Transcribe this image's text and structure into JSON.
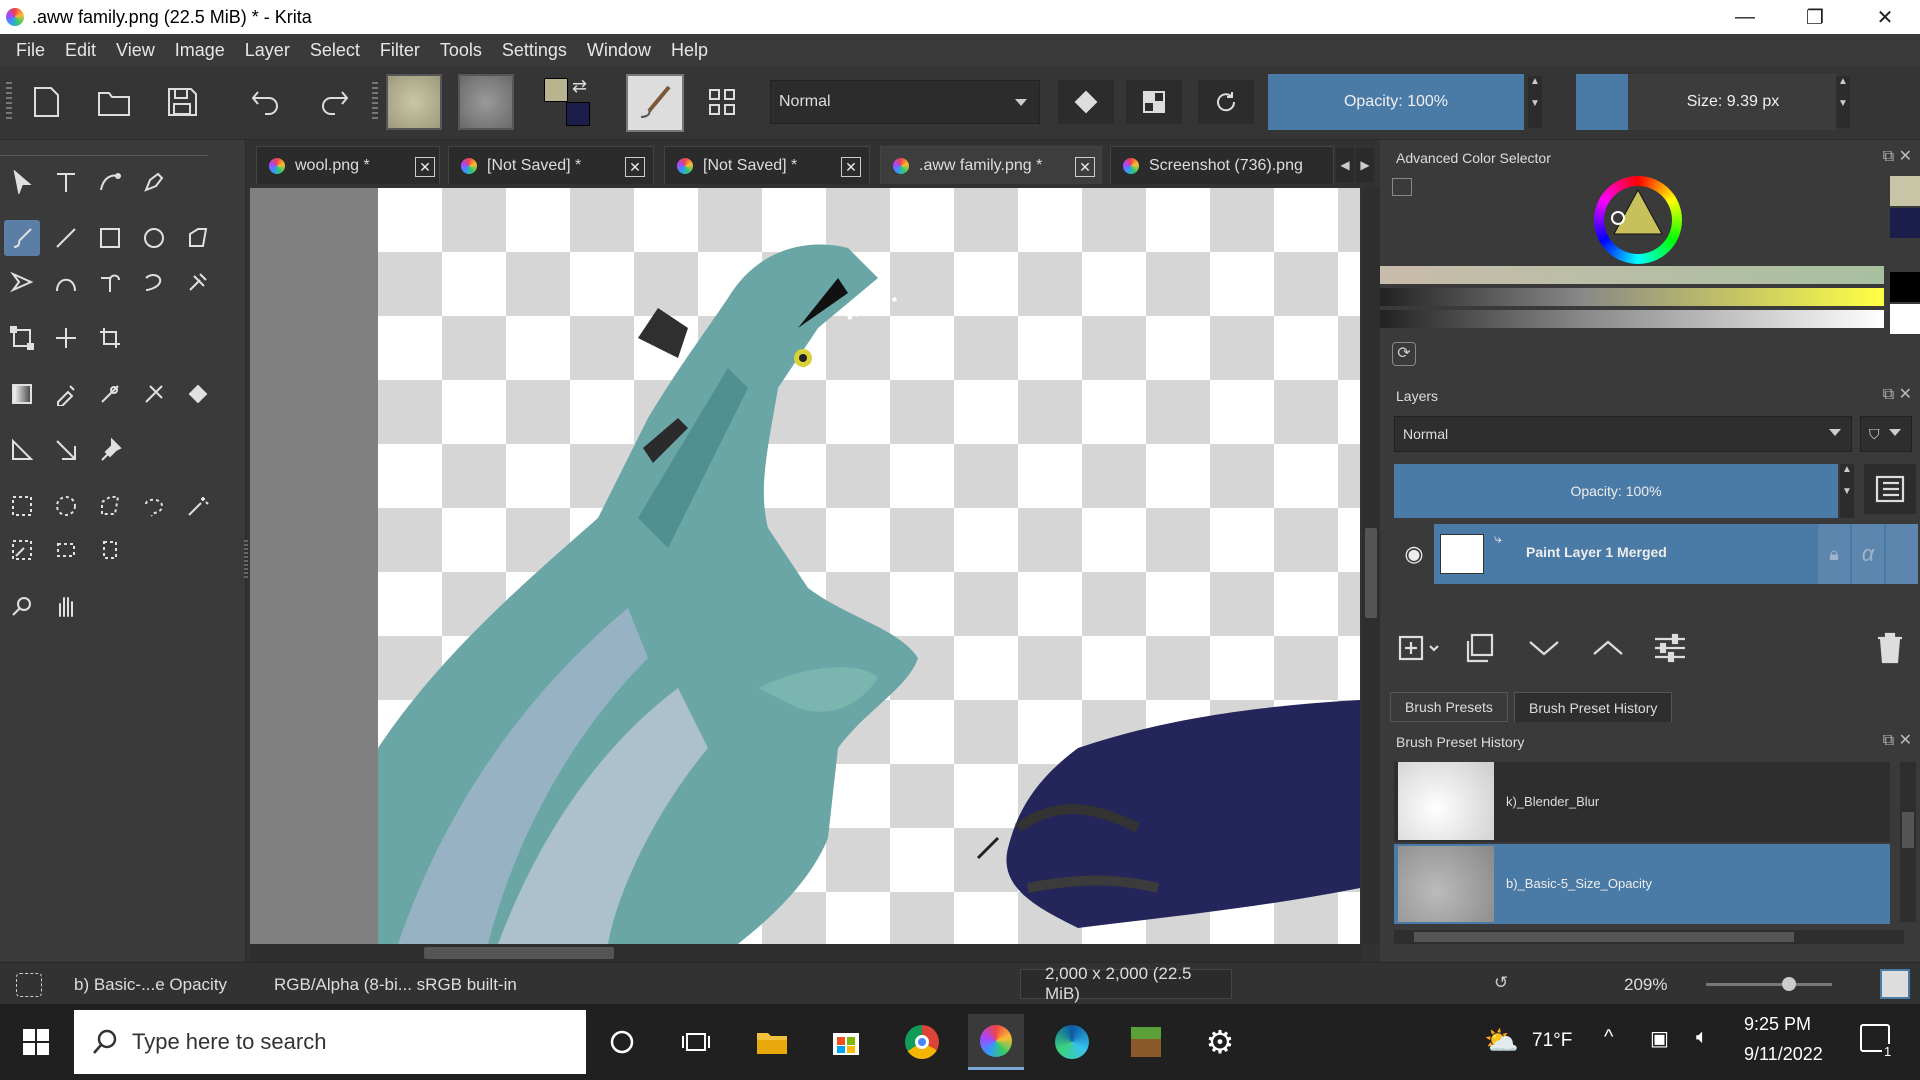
{
  "window": {
    "title": ".aww family.png (22.5 MiB)  * - Krita",
    "controls": [
      "—",
      "❐",
      "✕"
    ]
  },
  "menu": [
    "File",
    "Edit",
    "View",
    "Image",
    "Layer",
    "Select",
    "Filter",
    "Tools",
    "Settings",
    "Window",
    "Help"
  ],
  "toolbar": {
    "blend_mode": "Normal",
    "opacity_label": "Opacity: 100%",
    "size_label": "Size: 9.39 px",
    "fg_color": "#b9b48f",
    "bg_color": "#1b1d4a"
  },
  "tabs": [
    {
      "label": "wool.png *",
      "close": "✕"
    },
    {
      "label": "[Not Saved]  *",
      "close": "✕"
    },
    {
      "label": "[Not Saved]  *",
      "close": "✕"
    },
    {
      "label": ".aww family.png *",
      "close": "✕"
    },
    {
      "label": "Screenshot (736).png",
      "close": ""
    }
  ],
  "color_selector": {
    "title": "Advanced Color Selector",
    "swatches": [
      "#c7c5a6",
      "#1b1d4a",
      "#3a3a3a",
      "#000000",
      "#ffffff",
      "#303030"
    ]
  },
  "layers": {
    "title": "Layers",
    "blend_mode": "Normal",
    "opacity_label": "Opacity:  100%",
    "items": [
      {
        "name": "Paint Layer 1 Merged"
      }
    ]
  },
  "dock_tabs": {
    "presets": "Brush Presets",
    "history": "Brush Preset History"
  },
  "brush_history": {
    "title": "Brush Preset History",
    "items": [
      {
        "name": "k)_Blender_Blur"
      },
      {
        "name": "b)_Basic-5_Size_Opacity"
      }
    ]
  },
  "status": {
    "brush": "b) Basic-...e Opacity",
    "color_space": "RGB/Alpha (8-bi...  sRGB built-in",
    "dimensions": "2,000 x 2,000 (22.5 MiB)",
    "zoom": "209%"
  },
  "taskbar": {
    "search_placeholder": "Type here to search",
    "temperature": "71°F",
    "time": "9:25 PM",
    "date": "9/11/2022",
    "notification_count": "1"
  }
}
